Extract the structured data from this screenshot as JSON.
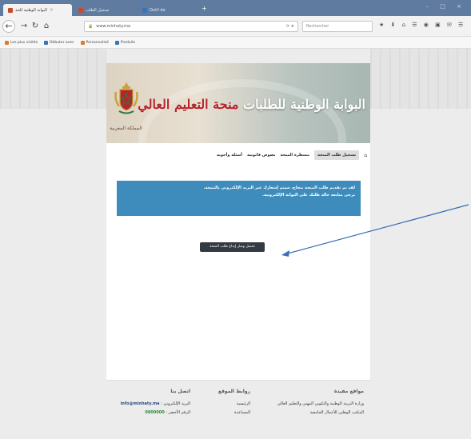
{
  "browser": {
    "tabs": [
      {
        "label": "البوابة الوطنية للحد",
        "active": true
      },
      {
        "label": "تسجيل الطلب",
        "active": false
      },
      {
        "label": "Outil de",
        "active": false
      }
    ],
    "url": "www.minhaty.ma",
    "search_placeholder": "Rechercher",
    "bookmarks": [
      "Les plus visités",
      "Débuter avec",
      "Personnalisé",
      "Produits"
    ]
  },
  "site": {
    "banner": {
      "emblem_label": "المملكة المغربية",
      "title_main": "البوابة الوطنية للطلبات",
      "title_accent": "منحة التعليم العالي"
    },
    "nav": {
      "home_icon": "home-icon",
      "items": [
        "تسجيل طلب المنحة",
        "مسطرة المنحة",
        "نصوص قانونية",
        "أسئلة وأجوبة"
      ],
      "active_index": 0
    },
    "notice": {
      "line1": "لقد تم تقديم طلب المنحة بنجاح، سيتم إشعارك عبر البريد الإلكتروني بالنتيجة.",
      "line2": "يرجى متابعة حالة طلبك على البوابة الإلكترونية."
    },
    "cta_label": "تحميل وصل إيداع طلب المنحة",
    "footer": {
      "col1_title": "مواقع مفيدة",
      "col1_lines": [
        "وزارة التربية الوطنية والتكوين المهني والتعليم العالي",
        "المكتب الوطني للأعمال الجامعية"
      ],
      "col2_title": "روابط الموقع",
      "col2_lines": [
        "الرئيسية",
        "المساعدة"
      ],
      "col3_title": "اتصل بنا",
      "col3_lines": [
        {
          "label": "البريد الإلكتروني",
          "value": "info@minhaty.ma"
        },
        {
          "label": "الرقم الأخضر",
          "value": "0800000"
        }
      ]
    }
  },
  "colors": {
    "info_box": "#3e8cbc",
    "cta_button": "#333a42",
    "annotation_arrow": "#3b6fb5"
  }
}
